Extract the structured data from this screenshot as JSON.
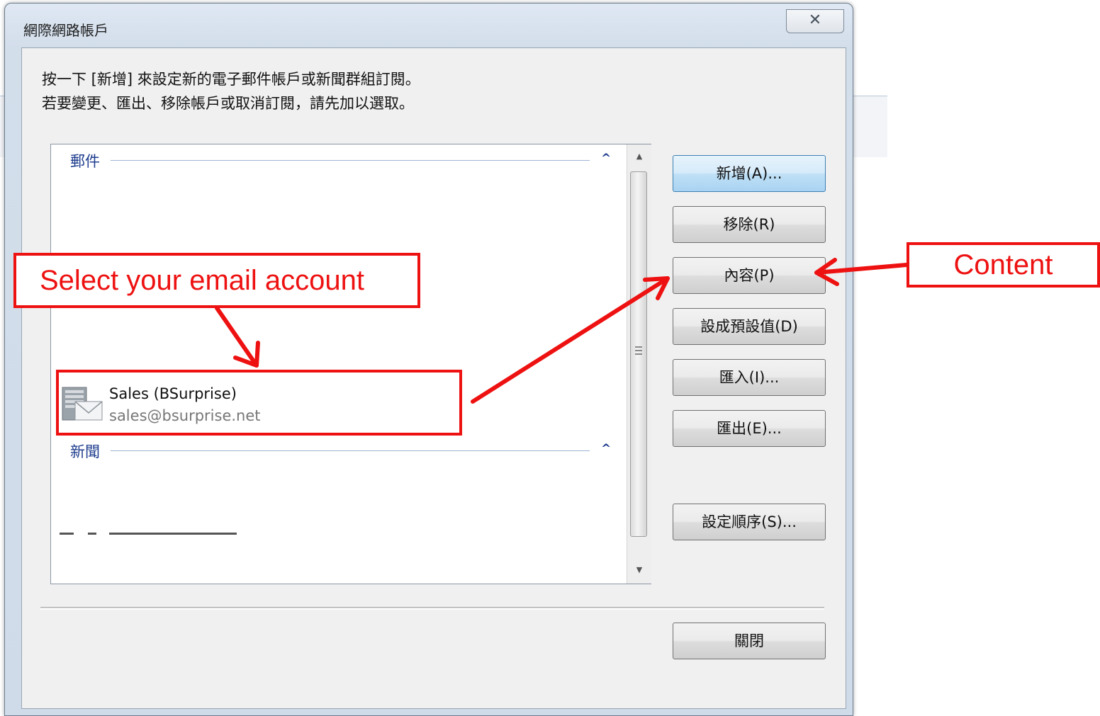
{
  "dialog": {
    "title": "網際網路帳戶",
    "close_glyph": "✕",
    "instruction_line1": "按一下 [新增] 來設定新的電子郵件帳戶或新聞群組訂閱。",
    "instruction_line2": "若要變更、匯出、移除帳戶或取消訂閱，請先加以選取。"
  },
  "account_list": {
    "groups": [
      {
        "label": "郵件",
        "collapse_icon": "chevron-up-icon"
      },
      {
        "label": "新聞",
        "collapse_icon": "chevron-up-icon"
      }
    ],
    "accounts": [
      {
        "name": "Sales (BSurprise)",
        "email": "sales@bsurprise.net",
        "icon": "mail-server-icon"
      }
    ]
  },
  "buttons": {
    "new": "新增(A)...",
    "remove": "移除(R)",
    "properties": "內容(P)",
    "set_default": "設成預設值(D)",
    "import": "匯入(I)...",
    "export": "匯出(E)...",
    "set_order": "設定順序(S)...",
    "close": "關閉"
  },
  "annotations": {
    "select_account": "Select your email account",
    "content": "Content",
    "color": "#ee1111"
  }
}
